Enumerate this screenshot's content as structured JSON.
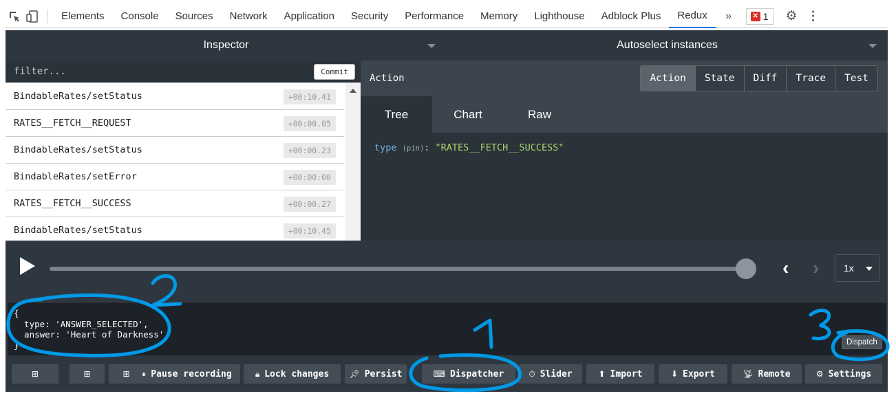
{
  "devtools": {
    "tabs": [
      "Elements",
      "Console",
      "Sources",
      "Network",
      "Application",
      "Security",
      "Performance",
      "Memory",
      "Lighthouse",
      "Adblock Plus",
      "Redux"
    ],
    "active_tab": "Redux",
    "more_tabs_label": "»",
    "error_count": "1"
  },
  "redux": {
    "instance_bar": {
      "monitor_select": "Inspector",
      "instance_select": "Autoselect instances"
    },
    "action_list": {
      "filter_placeholder": "filter...",
      "commit_label": "Commit",
      "items": [
        {
          "name": "BindableRates/setStatus",
          "time": "+00:10.41"
        },
        {
          "name": "RATES__FETCH__REQUEST",
          "time": "+00:00.05"
        },
        {
          "name": "BindableRates/setStatus",
          "time": "+00:00.23"
        },
        {
          "name": "BindableRates/setError",
          "time": "+00:00:00"
        },
        {
          "name": "RATES__FETCH__SUCCESS",
          "time": "+00:00.27"
        },
        {
          "name": "BindableRates/setStatus",
          "time": "+00:10.45"
        }
      ]
    },
    "monitor": {
      "header_title": "Action",
      "segments": [
        "Action",
        "State",
        "Diff",
        "Trace",
        "Test"
      ],
      "active_segment": "Action",
      "subtabs": [
        "Tree",
        "Chart",
        "Raw"
      ],
      "active_subtab": "Tree",
      "tree": {
        "key": "type",
        "pin": "(pin)",
        "colon": ":",
        "value": "\"RATES__FETCH__SUCCESS\""
      }
    },
    "slider": {
      "progress": 1.0,
      "speed": "1x"
    },
    "dispatcher": {
      "code_lines": [
        "{",
        "  type: 'ANSWER_SELECTED',",
        "  answer: 'Heart of Darkness'",
        "}"
      ],
      "dispatch_label": "Dispatch"
    },
    "toolbar": {
      "pause_label": "Pause recording",
      "lock_label": "Lock changes",
      "persist_label": "Persist",
      "dispatcher_label": "Dispatcher",
      "slider_label": "Slider",
      "import_label": "Import",
      "export_label": "Export",
      "remote_label": "Remote",
      "settings_label": "Settings"
    }
  },
  "annotations": {
    "color": "#0099e6",
    "labels": [
      "1",
      "2",
      "3"
    ]
  }
}
